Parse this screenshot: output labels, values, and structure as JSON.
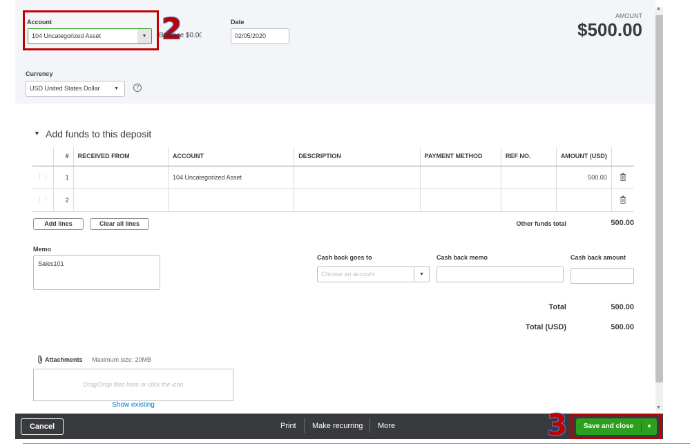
{
  "header": {
    "account_label": "Account",
    "account_value": "104 Uncategorized Asset",
    "balance_text": "Balance $0.00",
    "date_label": "Date",
    "date_value": "02/05/2020",
    "currency_label": "Currency",
    "currency_value": "USD United States Dollar",
    "amount_label": "AMOUNT",
    "amount_value": "$500.00"
  },
  "annotations": {
    "step2": "2",
    "step3": "3"
  },
  "section": {
    "title": "Add funds to this deposit"
  },
  "table": {
    "columns": [
      "#",
      "RECEIVED FROM",
      "ACCOUNT",
      "DESCRIPTION",
      "PAYMENT METHOD",
      "REF NO.",
      "AMOUNT (USD)"
    ],
    "rows": [
      {
        "num": "1",
        "received_from": "",
        "account": "104 Uncategorized Asset",
        "description": "",
        "payment_method": "",
        "ref_no": "",
        "amount": "500.00"
      },
      {
        "num": "2",
        "received_from": "",
        "account": "",
        "description": "",
        "payment_method": "",
        "ref_no": "",
        "amount": ""
      }
    ]
  },
  "actions": {
    "add_lines": "Add lines",
    "clear_all_lines": "Clear all lines",
    "other_funds_label": "Other funds total",
    "other_funds_value": "500.00"
  },
  "memo": {
    "label": "Memo",
    "value": "Sales101"
  },
  "cash_back": {
    "goes_to_label": "Cash back goes to",
    "goes_to_placeholder": "Choose an account",
    "memo_label": "Cash back memo",
    "amount_label": "Cash back amount"
  },
  "totals": {
    "total_label": "Total",
    "total_value": "500.00",
    "total_usd_label": "Total (USD)",
    "total_usd_value": "500.00"
  },
  "attachments": {
    "label": "Attachments",
    "max_size": "Maximum size: 20MB",
    "drop_text": "Drag/Drop files here or click the icon",
    "show_existing": "Show existing"
  },
  "footer": {
    "cancel": "Cancel",
    "print": "Print",
    "make_recurring": "Make recurring",
    "more": "More",
    "save_and_close": "Save and close"
  },
  "colors": {
    "save_green": "#2ca01c",
    "annotation_red": "#c00000",
    "footer_bg": "#393a3d"
  }
}
